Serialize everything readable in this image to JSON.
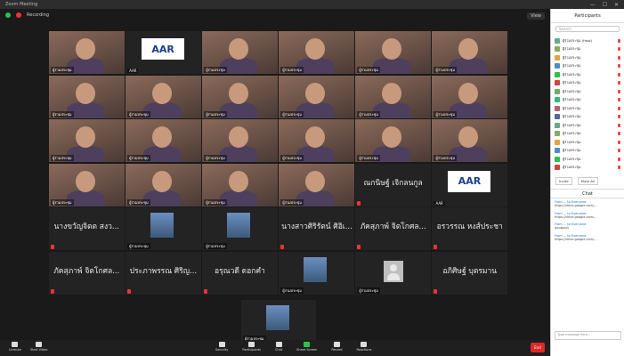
{
  "window": {
    "title": "Zoom Meeting"
  },
  "top": {
    "recording_label": "Recording",
    "view_label": "View"
  },
  "tiles": [
    {
      "type": "video",
      "label": "ผู้ร่วมประชุม"
    },
    {
      "type": "logo",
      "logo_text": "AAR",
      "label": "AAR"
    },
    {
      "type": "video",
      "label": "ผู้ร่วมประชุม"
    },
    {
      "type": "video",
      "label": "ผู้ร่วมประชุม"
    },
    {
      "type": "video",
      "label": "ผู้ร่วมประชุม"
    },
    {
      "type": "video",
      "label": "ผู้ร่วมประชุม"
    },
    {
      "type": "video",
      "label": "ผู้ร่วมประชุม"
    },
    {
      "type": "video",
      "label": "ผู้ร่วมประชุม"
    },
    {
      "type": "video",
      "label": "ผู้ร่วมประชุม"
    },
    {
      "type": "video",
      "label": "ผู้ร่วมประชุม"
    },
    {
      "type": "video",
      "label": "ผู้ร่วมประชุม"
    },
    {
      "type": "video",
      "label": "ผู้ร่วมประชุม"
    },
    {
      "type": "video",
      "label": "ผู้ร่วมประชุม"
    },
    {
      "type": "video",
      "label": "ผู้ร่วมประชุม"
    },
    {
      "type": "video",
      "label": "ผู้ร่วมประชุม"
    },
    {
      "type": "video",
      "label": "ผู้ร่วมประชุม"
    },
    {
      "type": "video",
      "label": "ผู้ร่วมประชุม"
    },
    {
      "type": "video",
      "label": "ผู้ร่วมประชุม"
    },
    {
      "type": "video",
      "label": "ผู้ร่วมประชุม"
    },
    {
      "type": "video",
      "label": "ผู้ร่วมประชุม"
    },
    {
      "type": "video",
      "label": "ผู้ร่วมประชุม"
    },
    {
      "type": "video",
      "label": "ผู้ร่วมประชุม"
    },
    {
      "type": "name",
      "name": "ณกนิษฐ์ เจิกลนกูล"
    },
    {
      "type": "logo",
      "logo_text": "AAR",
      "label": "AAR"
    },
    {
      "type": "name",
      "name": "นางขวัญจิตต สงว..."
    },
    {
      "type": "small",
      "label": "ผู้ร่วมประชุม"
    },
    {
      "type": "small",
      "label": "ผู้ร่วมประชุม"
    },
    {
      "type": "name",
      "name": "นางสาวศิริรัตน์ ศิอิเ..."
    },
    {
      "type": "name",
      "name": "ภัคสุภาพ์ จิตโกศล..."
    },
    {
      "type": "name",
      "name": "อรวรรณ หงส์ประชา"
    },
    {
      "type": "name",
      "name": "ภัคสุภาพ์ จิตโกศล..."
    },
    {
      "type": "name",
      "name": "ประภาพรรณ ศิริญ..."
    },
    {
      "type": "name",
      "name": "อรุณวดี ดอกคำ"
    },
    {
      "type": "small",
      "label": "ผู้ร่วมประชุม"
    },
    {
      "type": "avatar",
      "label": "ผู้ร่วมประชุม"
    },
    {
      "type": "name",
      "name": "อภิศิษฐ์ บุตรมาน"
    }
  ],
  "last_tile": {
    "label": "ผู้ร่วมประชุม"
  },
  "toolbar": {
    "left": [
      {
        "label": "Unmute"
      },
      {
        "label": "Start Video"
      }
    ],
    "mid": [
      {
        "label": "Security"
      },
      {
        "label": "Participants"
      },
      {
        "label": "Chat"
      },
      {
        "label": "Share Screen"
      },
      {
        "label": "Record"
      },
      {
        "label": "Reactions"
      }
    ],
    "end": "End"
  },
  "sidebar": {
    "participants_title": "Participants",
    "search_placeholder": "Search",
    "participants": [
      "ผู้ร่วมประชุม (Host)",
      "ผู้ร่วมประชุม",
      "ผู้ร่วมประชุม",
      "ผู้ร่วมประชุม",
      "ผู้ร่วมประชุม",
      "ผู้ร่วมประชุม",
      "ผู้ร่วมประชุม",
      "ผู้ร่วมประชุม",
      "ผู้ร่วมประชุม",
      "ผู้ร่วมประชุม",
      "ผู้ร่วมประชุม",
      "ผู้ร่วมประชุม",
      "ผู้ร่วมประชุม",
      "ผู้ร่วมประชุม",
      "ผู้ร่วมประชุม",
      "ผู้ร่วมประชุม"
    ],
    "invite_label": "Invite",
    "mute_all_label": "Mute All",
    "chat_title": "Chat",
    "messages": [
      {
        "from": "From ... to Everyone:",
        "text": "https://drive.google.com/..."
      },
      {
        "from": "From ... to Everyone:",
        "text": "https://drive.google.com/..."
      },
      {
        "from": "From ... to Everyone:",
        "text": "ขอบคุณค่ะ"
      },
      {
        "from": "From ... to Everyone:",
        "text": "https://drive.google.com/..."
      }
    ],
    "chat_placeholder": "Type message here..."
  }
}
